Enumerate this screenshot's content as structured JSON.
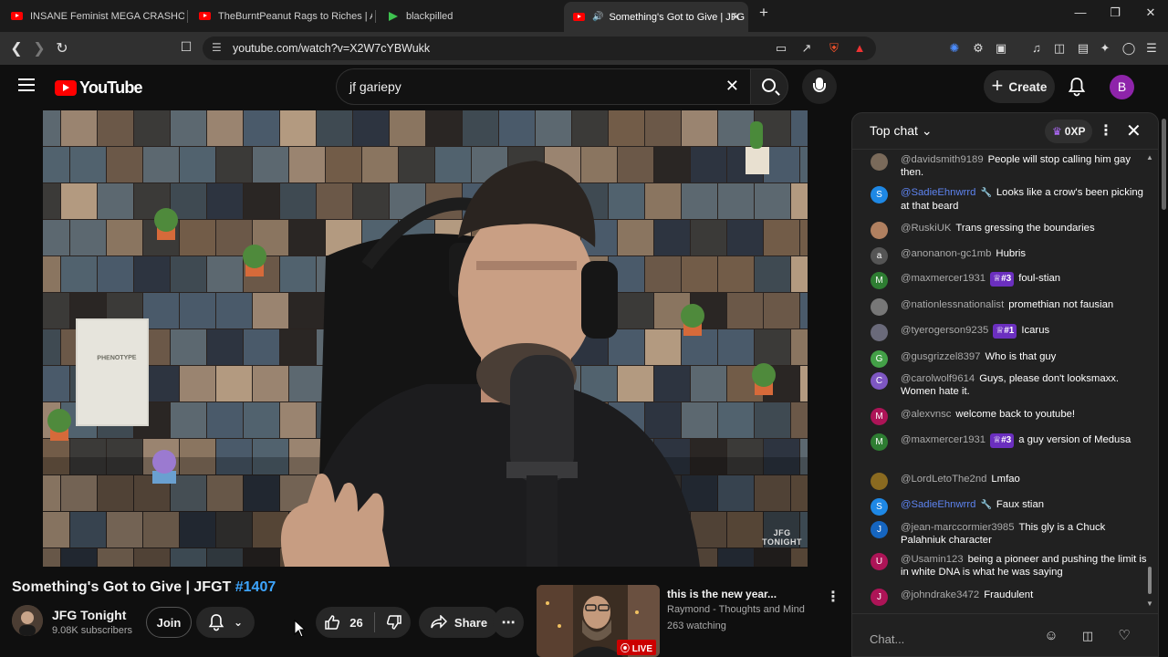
{
  "browser": {
    "tabs": [
      {
        "title": "INSANE Feminist MEGA CRASHOUT !",
        "icon": "youtube-icon"
      },
      {
        "title": "TheBurntPeanut Rags to Riches | ARC",
        "icon": "youtube-icon"
      },
      {
        "title": "blackpilled",
        "icon": "rumble-icon"
      },
      {
        "title": "Something's Got to Give | JFG",
        "icon": "youtube-icon",
        "active": true
      }
    ],
    "new_tab": "+",
    "url": "youtube.com/watch?v=X2W7cYBWukk"
  },
  "youtube": {
    "logo_text": "YouTube",
    "search_query": "jf gariepy",
    "create_label": "Create",
    "avatar_letter": "B"
  },
  "video": {
    "watermark_line1": "JFG",
    "watermark_line2": "TONIGHT",
    "book_title": "PHENOTYPE",
    "title": "Something's Got to Give | JFGT ",
    "title_tag": "#1407",
    "channel": "JFG Tonight",
    "subscribers": "9.08K subscribers",
    "join_label": "Join",
    "likes": "26",
    "share_label": "Share"
  },
  "suggested": {
    "title": "this is the new year...",
    "channel": "Raymond - Thoughts and Mind",
    "watching": "263 watching",
    "live_label": "LIVE"
  },
  "chat": {
    "header": "Top chat",
    "xp": "0XP",
    "input_placeholder": "Chat...",
    "messages": [
      {
        "author": "@davidsmith9189",
        "text": "People will stop calling him gay then.",
        "avatar": "",
        "color": "#7a6a5a"
      },
      {
        "author": "@SadieEhnwrrd",
        "mod": true,
        "text": "Looks like a crow's been picking at that beard",
        "avatar": "S",
        "color": "#1e88e5"
      },
      {
        "author": "@RuskiUK",
        "text": "Trans gressing the boundaries",
        "avatar": "",
        "color": "#b08060"
      },
      {
        "author": "@anonanon-gc1mb",
        "text": "Hubris",
        "avatar": "a",
        "color": "#555555"
      },
      {
        "author": "@maxmercer1931",
        "badge": "#3",
        "text": "foul-stian",
        "avatar": "M",
        "color": "#2e7d32"
      },
      {
        "author": "@nationlessnationalist",
        "text": "promethian not fausian",
        "avatar": "",
        "color": "#777777"
      },
      {
        "author": "@tyerogerson9235",
        "badge": "#1",
        "text": "Icarus",
        "avatar": "",
        "color": "#6a6a7a"
      },
      {
        "author": "@gusgrizzel8397",
        "text": "Who is that guy",
        "avatar": "G",
        "color": "#43a047"
      },
      {
        "author": "@carolwolf9614",
        "text": "Guys, please don't looksmaxx. Women hate it.",
        "avatar": "C",
        "color": "#7e57c2"
      },
      {
        "author": "@alexvnsc",
        "text": "welcome back to youtube!",
        "avatar": "M",
        "color": "#ad1457"
      },
      {
        "author": "@maxmercer1931",
        "badge": "#3",
        "text": "a guy version of Medusa",
        "avatar": "M",
        "color": "#2e7d32"
      },
      {
        "author": "@LordLetoThe2nd",
        "text": "Lmfao",
        "avatar": "",
        "color": "#8a6a20"
      },
      {
        "author": "@SadieEhnwrrd",
        "mod": true,
        "text": "Faux stian",
        "avatar": "S",
        "color": "#1e88e5"
      },
      {
        "author": "@jean-marccormier3985",
        "text": "This gly is a Chuck Palahniuk character",
        "avatar": "J",
        "color": "#1565c0"
      },
      {
        "author": "@Usamin123",
        "text": "being a pioneer and pushing the limit is in white DNA is what he was saying",
        "avatar": "U",
        "color": "#ad1457"
      },
      {
        "author": "@johndrake3472",
        "text": "Fraudulent",
        "avatar": "J",
        "color": "#ad1457"
      }
    ]
  }
}
